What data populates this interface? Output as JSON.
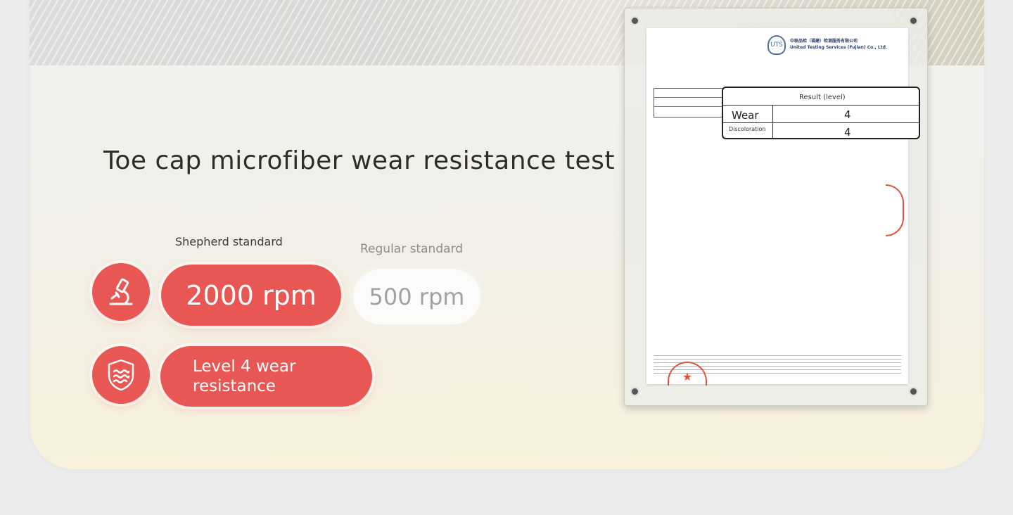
{
  "title": "Toe cap microfiber wear resistance test",
  "comparison": {
    "shepherd_label": "Shepherd standard",
    "regular_label": "Regular standard",
    "shepherd_value": "2000 rpm",
    "regular_value": "500 rpm",
    "wear_level_text": "Level 4 wear resistance"
  },
  "icons": {
    "row1": "microscope-icon",
    "row2": "shield-wave-icon"
  },
  "colors": {
    "accent": "#e85753",
    "title": "#2e2e22",
    "muted": "#a2a2a2"
  },
  "certificate": {
    "logo_text": "UTS",
    "company_line1": "中联品检（福建）检测服务有限公司",
    "company_line2": "United Testing Services (Fujian) Co., Ltd.",
    "result_header": "Result (level)",
    "rows": [
      {
        "label": "Wear",
        "value": "4"
      },
      {
        "label": "Discoloration",
        "value": "4"
      }
    ]
  }
}
